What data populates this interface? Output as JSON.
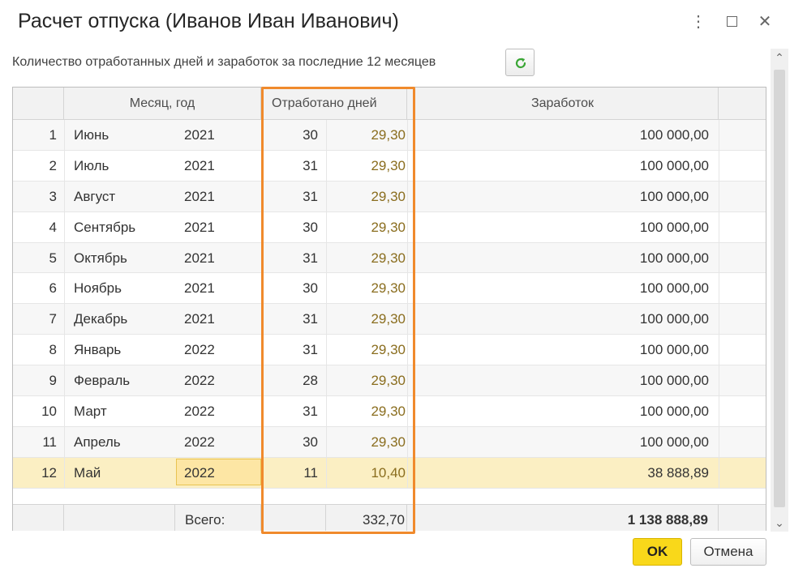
{
  "window": {
    "title": "Расчет отпуска (Иванов Иван Иванович)",
    "more_glyph": "⋮",
    "close_glyph": "✕"
  },
  "subtitle": "Количество отработанных дней и заработок за последние 12 месяцев",
  "refresh_icon": "refresh-icon",
  "colors": {
    "accent_yellow": "#f9d81a",
    "highlight_orange": "#f08a2c",
    "refresh_green": "#3aa635",
    "worked_text": "#8a6d1e",
    "selected_row": "#fbefc3"
  },
  "table": {
    "headers": {
      "month_year": "Месяц, год",
      "days_worked": "Отработано дней",
      "earnings": "Заработок"
    },
    "rows": [
      {
        "n": "1",
        "month": "Июнь",
        "year": "2021",
        "calendar_days": "30",
        "worked": "29,30",
        "earnings": "100 000,00"
      },
      {
        "n": "2",
        "month": "Июль",
        "year": "2021",
        "calendar_days": "31",
        "worked": "29,30",
        "earnings": "100 000,00"
      },
      {
        "n": "3",
        "month": "Август",
        "year": "2021",
        "calendar_days": "31",
        "worked": "29,30",
        "earnings": "100 000,00"
      },
      {
        "n": "4",
        "month": "Сентябрь",
        "year": "2021",
        "calendar_days": "30",
        "worked": "29,30",
        "earnings": "100 000,00"
      },
      {
        "n": "5",
        "month": "Октябрь",
        "year": "2021",
        "calendar_days": "31",
        "worked": "29,30",
        "earnings": "100 000,00"
      },
      {
        "n": "6",
        "month": "Ноябрь",
        "year": "2021",
        "calendar_days": "30",
        "worked": "29,30",
        "earnings": "100 000,00"
      },
      {
        "n": "7",
        "month": "Декабрь",
        "year": "2021",
        "calendar_days": "31",
        "worked": "29,30",
        "earnings": "100 000,00"
      },
      {
        "n": "8",
        "month": "Январь",
        "year": "2022",
        "calendar_days": "31",
        "worked": "29,30",
        "earnings": "100 000,00"
      },
      {
        "n": "9",
        "month": "Февраль",
        "year": "2022",
        "calendar_days": "28",
        "worked": "29,30",
        "earnings": "100 000,00"
      },
      {
        "n": "10",
        "month": "Март",
        "year": "2022",
        "calendar_days": "31",
        "worked": "29,30",
        "earnings": "100 000,00"
      },
      {
        "n": "11",
        "month": "Апрель",
        "year": "2022",
        "calendar_days": "30",
        "worked": "29,30",
        "earnings": "100 000,00"
      },
      {
        "n": "12",
        "month": "Май",
        "year": "2022",
        "calendar_days": "11",
        "worked": "10,40",
        "earnings": "38 888,89"
      }
    ],
    "selected_row": 11,
    "totals": {
      "label": "Всего:",
      "worked": "332,70",
      "earnings": "1 138 888,89"
    }
  },
  "buttons": {
    "ok": "OK",
    "cancel": "Отмена"
  }
}
